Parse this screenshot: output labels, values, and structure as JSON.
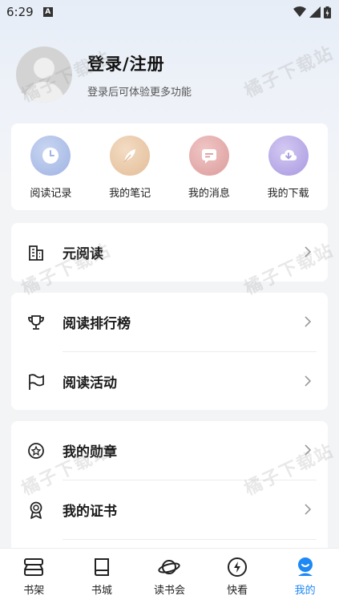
{
  "status_bar": {
    "time": "6:29",
    "indicator": "A"
  },
  "profile": {
    "title": "登录/注册",
    "subtitle": "登录后可体验更多功能"
  },
  "quick_actions": [
    {
      "label": "阅读记录",
      "icon": "clock-icon",
      "color": "#a9bde6"
    },
    {
      "label": "我的笔记",
      "icon": "feather-icon",
      "color": "#e9c9a9"
    },
    {
      "label": "我的消息",
      "icon": "message-icon",
      "color": "#e3a9a9"
    },
    {
      "label": "我的下载",
      "icon": "cloud-download-icon",
      "color": "#b6a9e6"
    }
  ],
  "menu_group_1": [
    {
      "label": "元阅读",
      "icon": "building-icon"
    }
  ],
  "menu_group_2": [
    {
      "label": "阅读排行榜",
      "icon": "trophy-icon"
    },
    {
      "label": "阅读活动",
      "icon": "flag-icon"
    }
  ],
  "menu_group_3": [
    {
      "label": "我的勋章",
      "icon": "medal-icon"
    },
    {
      "label": "我的证书",
      "icon": "certificate-icon"
    }
  ],
  "tabs": [
    {
      "label": "书架",
      "icon": "bookshelf-icon"
    },
    {
      "label": "书城",
      "icon": "book-icon"
    },
    {
      "label": "读书会",
      "icon": "planet-icon"
    },
    {
      "label": "快看",
      "icon": "lightning-icon"
    },
    {
      "label": "我的",
      "icon": "profile-icon",
      "active": true
    }
  ],
  "watermark": "橘子下载站",
  "colors": {
    "accent": "#1e88f5"
  }
}
